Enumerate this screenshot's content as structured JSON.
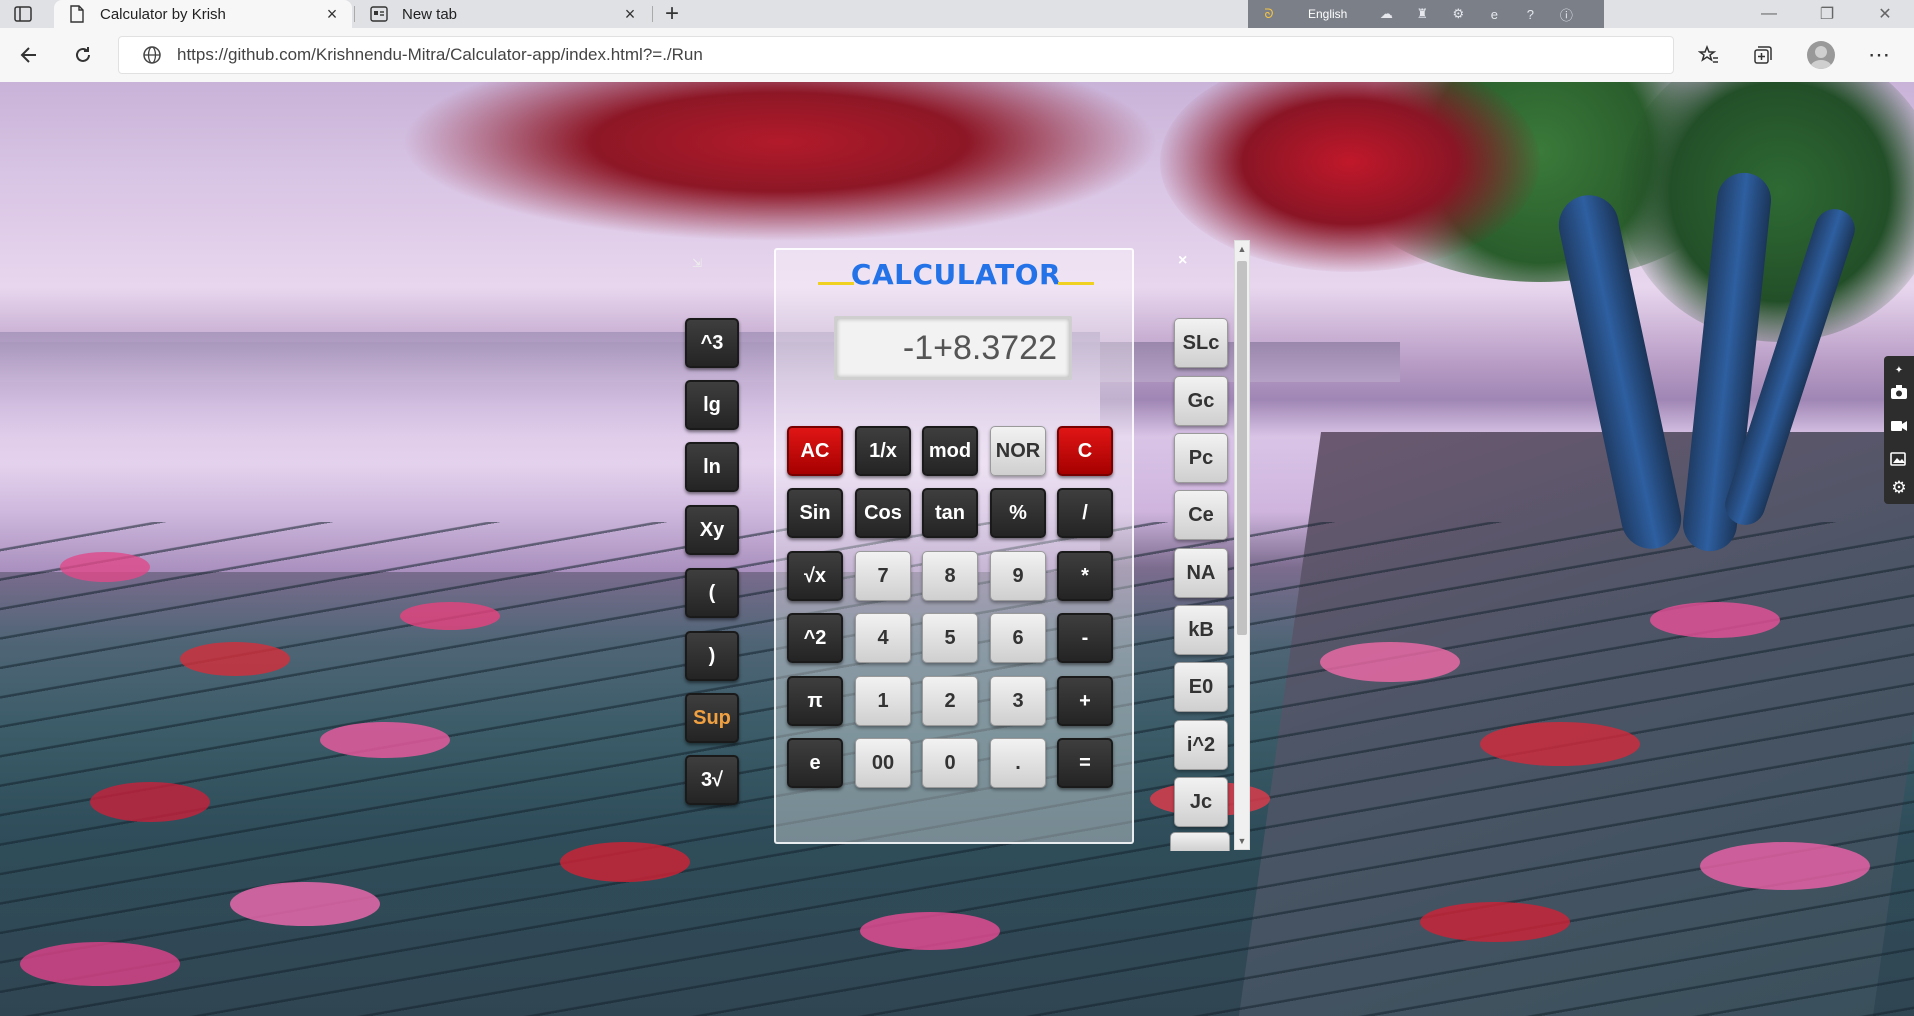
{
  "browser": {
    "tabs": [
      {
        "title": "Calculator by Krish",
        "active": true
      },
      {
        "title": "New tab",
        "active": false
      }
    ],
    "url": "https://github.com/Krishnendu-Mitra/Calculator-app/index.html?=./Run",
    "ime_language": "English"
  },
  "calculator": {
    "title": "CALCULATOR",
    "display_value": "-1+8.3722",
    "left_column": [
      "^3",
      "lg",
      "ln",
      "Xy",
      "(",
      ")",
      "Sup",
      "3√"
    ],
    "grid": [
      [
        "AC",
        "1/x",
        "mod",
        "NOR",
        "C"
      ],
      [
        "Sin",
        "Cos",
        "tan",
        "%",
        "/"
      ],
      [
        "√x",
        "7",
        "8",
        "9",
        "*"
      ],
      [
        "^2",
        "4",
        "5",
        "6",
        "-"
      ],
      [
        "π",
        "1",
        "2",
        "3",
        "+"
      ],
      [
        "e",
        "00",
        "0",
        ".",
        "="
      ]
    ],
    "right_column": [
      "SLc",
      "Gc",
      "Pc",
      "Ce",
      "NA",
      "kB",
      "E0",
      "i^2",
      "Jc"
    ],
    "close_label": "×"
  },
  "colors": {
    "title_blue": "#2372e8",
    "accent_red": "#c80000",
    "dark_button": "#2e2e2e"
  }
}
